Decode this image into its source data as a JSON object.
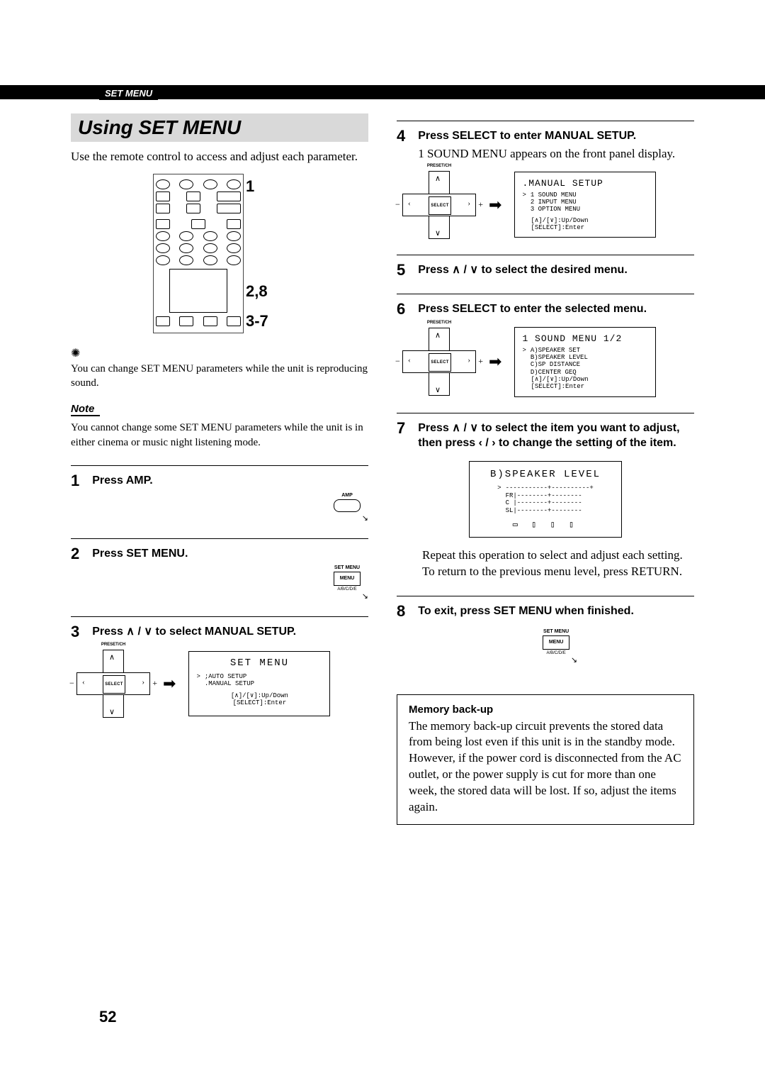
{
  "header": {
    "section_tab": "SET MENU",
    "title": "Using SET MENU"
  },
  "page_number": "52",
  "left": {
    "intro": "Use the remote control to access and adjust each parameter.",
    "callouts": {
      "c1": "1",
      "c2": "2,8",
      "c3": "3-7"
    },
    "tip": "You can change SET MENU parameters while the unit is reproducing sound.",
    "note_label": "Note",
    "note_text": "You cannot change some SET MENU parameters while the unit is in either cinema or music night listening mode.",
    "steps": {
      "s1": {
        "num": "1",
        "head": "Press AMP."
      },
      "s2": {
        "num": "2",
        "head": "Press SET MENU."
      },
      "s3": {
        "num": "3",
        "head": "Press ∧ / ∨ to select MANUAL SETUP."
      }
    },
    "dpad": {
      "top_label": "PRESET/CH",
      "select": "SELECT",
      "minus": "−",
      "plus": "+"
    },
    "lcd_setmenu": {
      "title": "SET MENU",
      "l1": ";AUTO SETUP",
      "l2": ".MANUAL SETUP",
      "hint1": "[∧]/[∨]:Up/Down",
      "hint2": "[SELECT]:Enter",
      "marker": ">"
    },
    "mini_amp": {
      "label": "AMP"
    },
    "mini_setmenu": {
      "label_top": "SET MENU",
      "btn": "MENU",
      "label_bottom": "A/B/C/D/E"
    }
  },
  "right": {
    "steps": {
      "s4": {
        "num": "4",
        "head": "Press SELECT to enter MANUAL SETUP.",
        "after": "1 SOUND MENU appears on the front panel display."
      },
      "s5": {
        "num": "5",
        "head": "Press ∧ / ∨ to select the desired menu."
      },
      "s6": {
        "num": "6",
        "head": "Press SELECT to enter the selected menu."
      },
      "s7": {
        "num": "7",
        "head": "Press ∧ / ∨ to select the item you want to adjust, then press ‹ / › to change the setting of the item.",
        "after": "Repeat this operation to select and adjust each setting. To return to the previous menu level, press RETURN."
      },
      "s8": {
        "num": "8",
        "head": "To exit, press SET MENU when finished."
      }
    },
    "lcd_manual": {
      "title": ".MANUAL SETUP",
      "l1": "1 SOUND MENU",
      "l2": "2 INPUT MENU",
      "l3": "3 OPTION MENU",
      "hint1": "[∧]/[∨]:Up/Down",
      "hint2": "[SELECT]:Enter",
      "marker": ">"
    },
    "lcd_sound": {
      "title": "1 SOUND MENU 1/2",
      "l1": "A)SPEAKER SET",
      "l2": "B)SPEAKER LEVEL",
      "l3": "C)SP DISTANCE",
      "l4": "D)CENTER GEQ",
      "hint1": "[∧]/[∨]:Up/Down",
      "hint2": "[SELECT]:Enter",
      "marker": ">"
    },
    "lcd_level": {
      "title": "B)SPEAKER LEVEL",
      "ruler": "-----------+----------+",
      "r1": "FR|--------+--------",
      "r2": "C |--------+--------",
      "r3": "SL|--------+--------",
      "marker": ">"
    },
    "mini_setmenu": {
      "label_top": "SET MENU",
      "btn": "MENU",
      "label_bottom": "A/B/C/D/E"
    },
    "memory": {
      "title": "Memory back-up",
      "text": "The memory back-up circuit prevents the stored data from being lost even if this unit is in the standby mode. However, if the power cord is disconnected from the AC outlet, or the power supply is cut for more than one week, the stored data will be lost. If so, adjust the items again."
    }
  }
}
